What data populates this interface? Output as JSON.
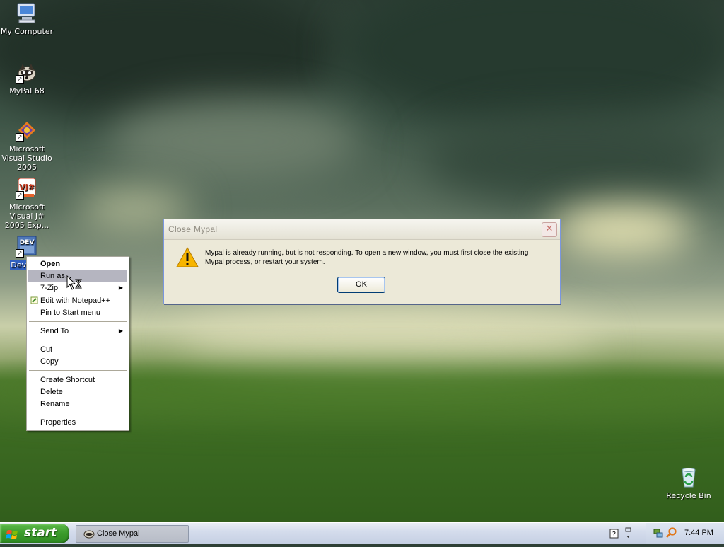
{
  "desktop": {
    "icons": [
      {
        "label": "My Computer",
        "icon": "my-computer-icon"
      },
      {
        "label": "MyPal 68",
        "icon": "mypal-icon"
      },
      {
        "label": "Microsoft Visual Studio 2005",
        "icon": "visual-studio-icon"
      },
      {
        "label": "Microsoft Visual J# 2005 Exp...",
        "icon": "visual-jsharp-icon"
      },
      {
        "label": "Dev-",
        "icon": "dev-cpp-icon"
      },
      {
        "label": "Recycle Bin",
        "icon": "recycle-bin-icon"
      }
    ],
    "shortcut_arrow": "↗"
  },
  "dialog": {
    "title": "Close Mypal",
    "close_glyph": "✕",
    "message": "Mypal is already running, but is not responding. To open a new window, you must first close the existing Mypal process, or restart your system.",
    "ok_label": "OK",
    "icon": "warning-icon"
  },
  "context_menu": {
    "items": [
      {
        "label": "Open",
        "bold": true
      },
      {
        "label": "Run as...",
        "highlighted": true
      },
      {
        "label": "7-Zip",
        "submenu": true
      },
      {
        "label": "Edit with Notepad++",
        "icon": "notepad-plus-plus-icon"
      },
      {
        "label": "Pin to Start menu"
      },
      {
        "label": "Send To",
        "submenu": true
      },
      {
        "label": "Cut"
      },
      {
        "label": "Copy"
      },
      {
        "label": "Create Shortcut"
      },
      {
        "label": "Delete"
      },
      {
        "label": "Rename"
      },
      {
        "label": "Properties"
      }
    ],
    "submenu_glyph": "▶"
  },
  "taskbar": {
    "start_label": "start",
    "window_button": "Close Mypal",
    "clock": "7:44 PM",
    "colors": {
      "start": "#3a9a2a",
      "taskbar": "#d4dcec"
    }
  }
}
